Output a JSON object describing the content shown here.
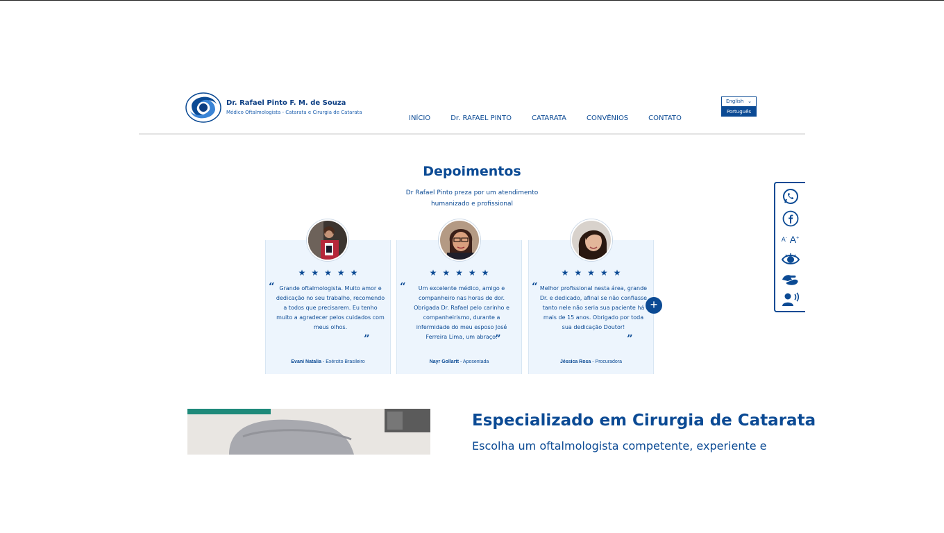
{
  "brand": {
    "name": "Dr. Rafael Pinto F. M. de Souza",
    "subtitle": "Médico Oftalmologista - Catarata e Cirurgia de Catarata"
  },
  "nav": {
    "items": [
      "INÍCIO",
      "Dr. RAFAEL PINTO",
      "CATARATA",
      "CONVÊNIOS",
      "CONTATO"
    ]
  },
  "language": {
    "selected": "English",
    "option": "Português"
  },
  "testimonials": {
    "title": "Depoimentos",
    "subtitle": "Dr Rafael Pinto preza por um atendimento humanizado e profissional",
    "cards": [
      {
        "stars": "★★★★★",
        "text": "Grande oftalmologista. Muito amor e dedicação no seu trabalho, recomendo a todos que precisarem. Eu tenho muito a agradecer pelos cuidados com meus olhos.",
        "name": "Evani Natalia",
        "role": " - Exército Brasileiro"
      },
      {
        "stars": "★★★★★",
        "text": "Um excelente médico, amigo e companheiro nas horas de dor. Obrigada Dr. Rafael pelo carinho e companheirismo, durante a infermidade do meu esposo José Ferreira Lima, um abraço.",
        "name": "Nayr Gollartt",
        "role": " - Aposentada"
      },
      {
        "stars": "★★★★★",
        "text": "Melhor profissional nesta área, grande Dr. e dedicado, afinal se não confiasse tanto nele não seria sua paciente há mais de 15 anos. Obrigado por toda sua dedicação Doutor!",
        "name": "Jéssica Rosa",
        "role": " - Procuradora"
      }
    ],
    "more_label": "+"
  },
  "accessibility": {
    "font_small": "A",
    "font_small_sign": "-",
    "font_large": "A",
    "font_large_sign": "+",
    "icons": [
      "whatsapp-icon",
      "facebook-icon",
      "font-size-icon",
      "contrast-eye-icon",
      "sign-language-icon",
      "screen-reader-icon"
    ]
  },
  "specialization": {
    "title": "Especializado em Cirurgia de Catarata",
    "subtitle": "Escolha um oftalmologista competente, experiente e"
  },
  "colors": {
    "primary": "#0b4a94",
    "card_bg": "#edf5fd"
  }
}
